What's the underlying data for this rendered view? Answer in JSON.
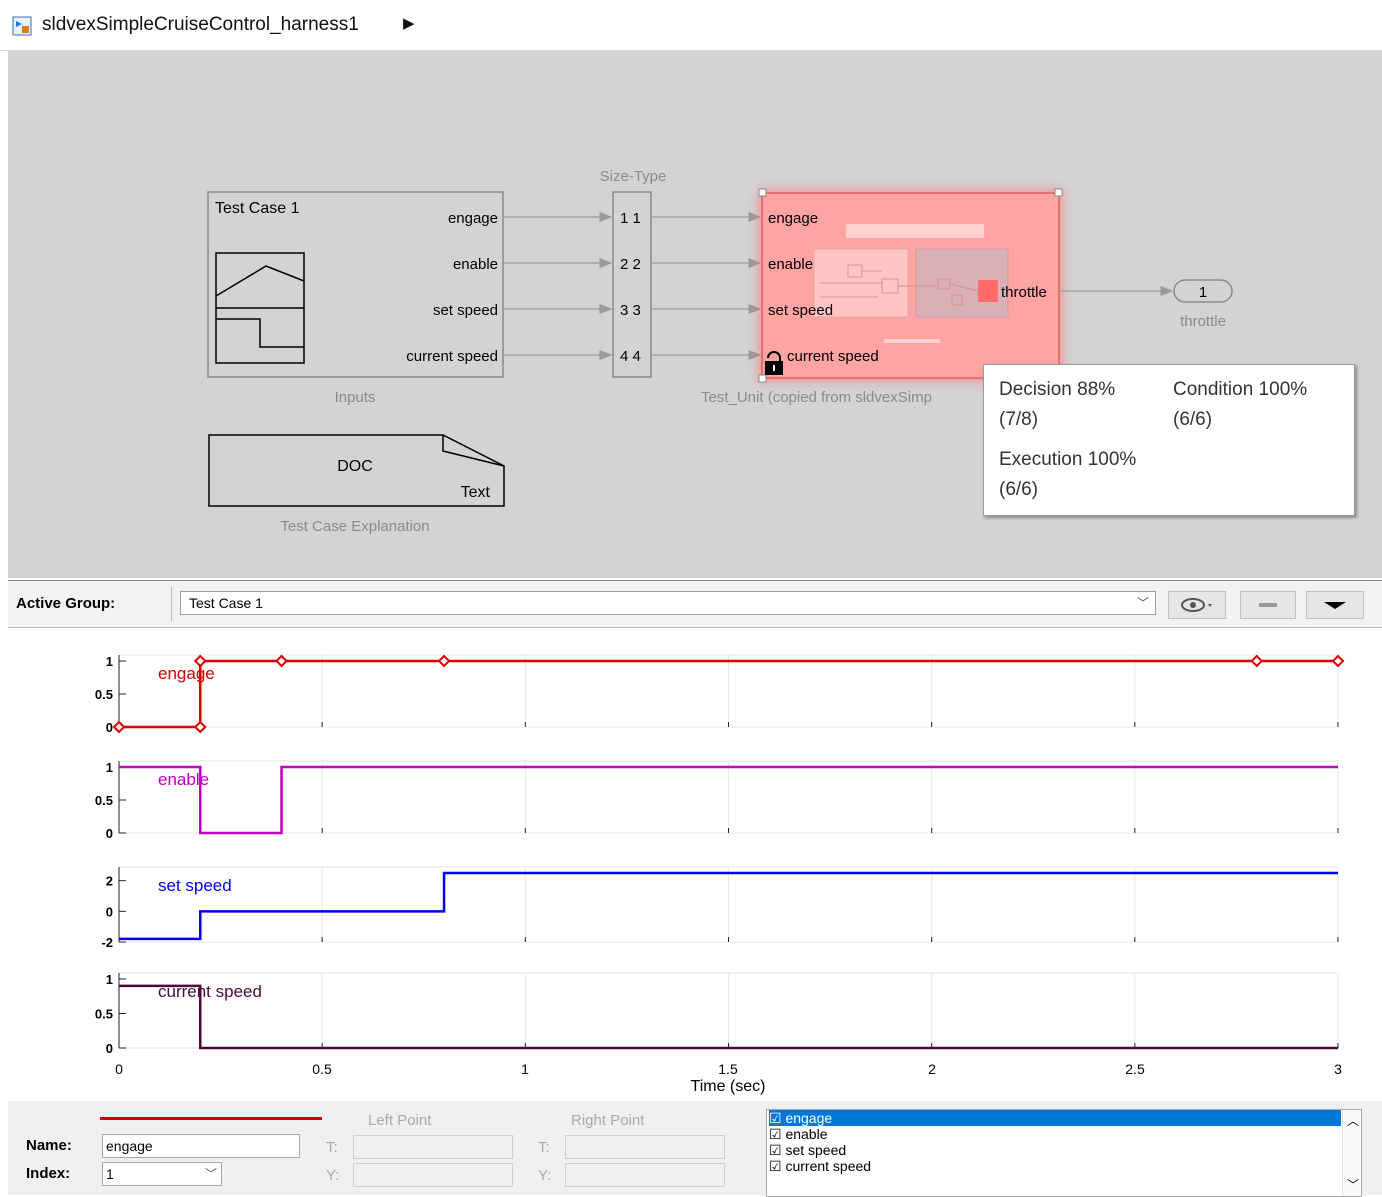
{
  "window": {
    "title": "sldvexSimpleCruiseControl_harness1",
    "breadcrumb_arrow": "▶"
  },
  "colors": {
    "engage": "#dd0000",
    "enable": "#c000c0",
    "set_speed": "#0000ee",
    "current_speed": "#4a0a3c",
    "selection": "#0078d7",
    "highlight_block": "#ff9e9e"
  },
  "diagram": {
    "inputs_block": {
      "title": "Test Case 1",
      "caption": "Inputs",
      "ports": [
        "engage",
        "enable",
        "set speed",
        "current speed"
      ]
    },
    "size_type_block": {
      "caption": "Size-Type",
      "rows": [
        "1  1",
        "2  2",
        "3  3",
        "4  4"
      ]
    },
    "test_unit_block": {
      "caption": "Test_Unit (copied from sldvexSimp",
      "inports": [
        "engage",
        "enable",
        "set speed",
        "current speed"
      ],
      "outport": "throttle"
    },
    "outport": {
      "number": "1",
      "caption": "throttle"
    },
    "doc_block": {
      "title": "DOC",
      "subtitle": "Text",
      "caption": "Test Case Explanation"
    },
    "icons": [
      "simulink-model-icon",
      "lock-icon"
    ]
  },
  "coverage_tooltip": {
    "decision": "Decision 88%",
    "decision_frac": "(7/8)",
    "condition": "Condition 100%",
    "condition_frac": "(6/6)",
    "execution": "Execution 100%",
    "execution_frac": "(6/6)"
  },
  "signal_builder": {
    "active_group_label": "Active Group:",
    "active_group_value": "Test Case 1",
    "toolbar_icons": [
      "signal-visibility-icon",
      "menu-dropdown-icon"
    ],
    "x_axis": {
      "label": "Time (sec)",
      "ticks": [
        "0",
        "0.5",
        "1",
        "1.5",
        "2",
        "2.5",
        "3"
      ],
      "range": [
        0,
        3
      ]
    },
    "plots": [
      {
        "name": "engage",
        "yticks": [
          "1",
          "0.5",
          "0"
        ],
        "ylim": [
          0,
          1
        ]
      },
      {
        "name": "enable",
        "yticks": [
          "1",
          "0.5",
          "0"
        ],
        "ylim": [
          0,
          1
        ]
      },
      {
        "name": "set speed",
        "yticks": [
          "2",
          "0",
          "-2"
        ],
        "ylim": [
          -2,
          2.5
        ]
      },
      {
        "name": "current speed",
        "yticks": [
          "1",
          "0.5",
          "0"
        ],
        "ylim": [
          0,
          1
        ]
      }
    ],
    "name_label": "Name:",
    "name_value": "engage",
    "index_label": "Index:",
    "index_value": "1",
    "left_point_label": "Left Point",
    "right_point_label": "Right Point",
    "t_label": "T:",
    "y_label": "Y:",
    "signal_list": [
      "engage",
      "enable",
      "set speed",
      "current speed"
    ],
    "checkbox_glyph": "☑"
  },
  "chart_data": {
    "type": "line",
    "xlabel": "Time (sec)",
    "xlim": [
      0,
      3
    ],
    "series": [
      {
        "name": "engage",
        "x": [
          0,
          0.2,
          0.2,
          0.4,
          0.8,
          2.8,
          3.0
        ],
        "y": [
          0,
          0,
          1,
          1,
          1,
          1,
          1
        ],
        "markers": [
          0,
          0.2,
          0.2,
          0.4,
          0.8,
          2.8,
          3.0
        ]
      },
      {
        "name": "enable",
        "x": [
          0,
          0.2,
          0.2,
          0.4,
          0.4,
          3.0
        ],
        "y": [
          1,
          1,
          0,
          0,
          1,
          1
        ]
      },
      {
        "name": "set speed",
        "x": [
          0,
          0.2,
          0.2,
          0.8,
          0.8,
          3.0
        ],
        "y": [
          -1.8,
          -1.8,
          0,
          0,
          2.5,
          2.5
        ]
      },
      {
        "name": "current speed",
        "x": [
          0,
          0.2,
          0.2,
          3.0
        ],
        "y": [
          0.9,
          0.9,
          0,
          0
        ]
      }
    ]
  }
}
